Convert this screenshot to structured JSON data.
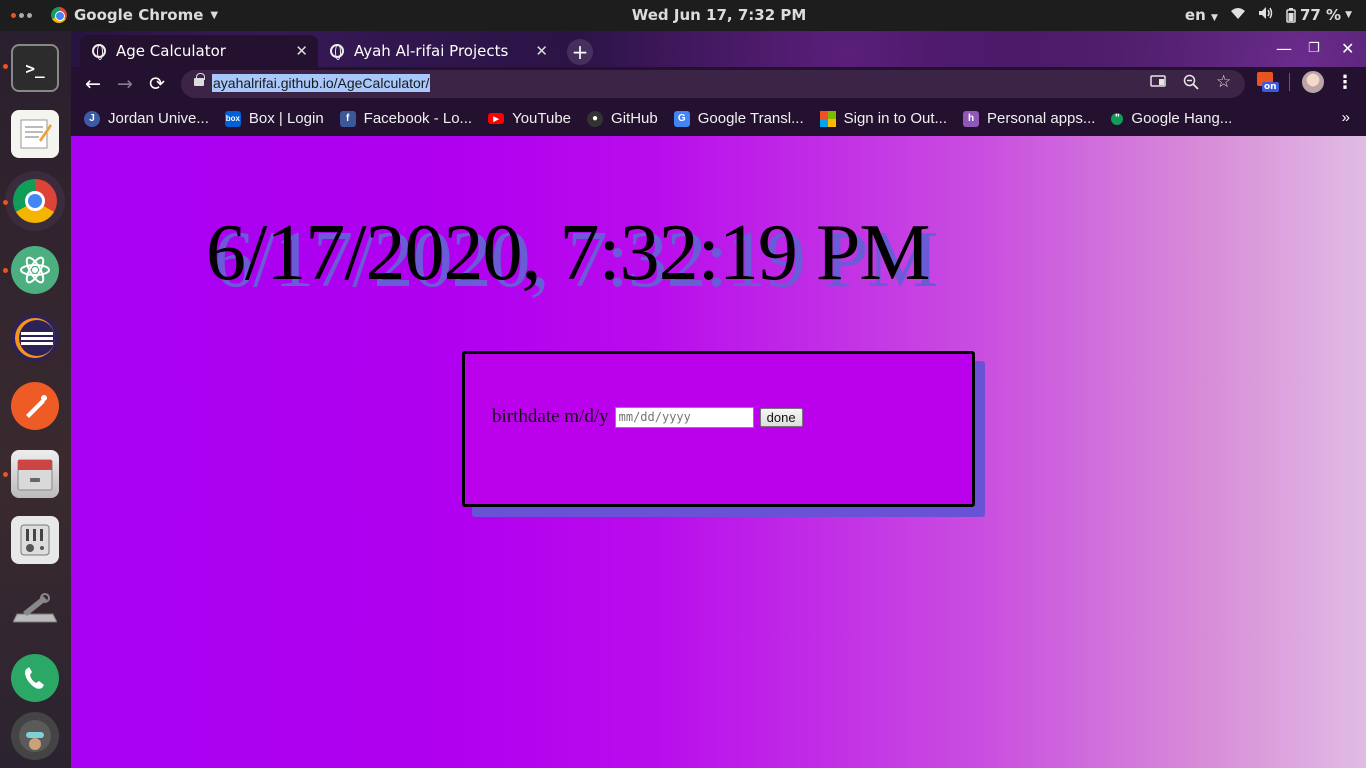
{
  "topbar": {
    "app_name": "Google Chrome",
    "clock": "Wed Jun 17,  7:32 PM",
    "language": "en",
    "battery": "77 %"
  },
  "dock": {
    "items": [
      {
        "name": "terminal",
        "running": true
      },
      {
        "name": "text-editor",
        "running": false
      },
      {
        "name": "chrome",
        "running": true
      },
      {
        "name": "atom",
        "running": true
      },
      {
        "name": "eclipse",
        "running": false
      },
      {
        "name": "postman",
        "running": false
      },
      {
        "name": "files",
        "running": true
      },
      {
        "name": "system-settings",
        "running": false
      },
      {
        "name": "disk-tools",
        "running": false
      },
      {
        "name": "phone",
        "running": false
      },
      {
        "name": "avatar",
        "running": false
      }
    ]
  },
  "browser": {
    "tabs": [
      {
        "title": "Age Calculator",
        "active": true
      },
      {
        "title": "Ayah Al-rifai Projects",
        "active": false
      }
    ],
    "url": "ayahalrifai.github.io/AgeCalculator/",
    "extension_badge": "on",
    "bookmarks": [
      {
        "label": "Jordan Unive...",
        "icon": "ju-icon",
        "color": "#3b5ba8"
      },
      {
        "label": "Box | Login",
        "icon": "box-icon",
        "color": "#0061d5"
      },
      {
        "label": "Facebook - Lo...",
        "icon": "facebook-icon",
        "color": "#3b5998"
      },
      {
        "label": "YouTube",
        "icon": "youtube-icon",
        "color": "#ff0000"
      },
      {
        "label": "GitHub",
        "icon": "github-icon",
        "color": "#333333"
      },
      {
        "label": "Google Transl...",
        "icon": "translate-icon",
        "color": "#4285f4"
      },
      {
        "label": "Sign in to Out...",
        "icon": "microsoft-icon",
        "color": "#f25022"
      },
      {
        "label": "Personal apps...",
        "icon": "heroku-icon",
        "color": "#8e57b8"
      },
      {
        "label": "Google Hang...",
        "icon": "hangouts-icon",
        "color": "#0f9d58"
      }
    ]
  },
  "page": {
    "datetime": "6/17/2020, 7:32:19 PM",
    "label": "birthdate m/d/y",
    "input_placeholder": "mm/dd/yyyy",
    "button": "done"
  }
}
